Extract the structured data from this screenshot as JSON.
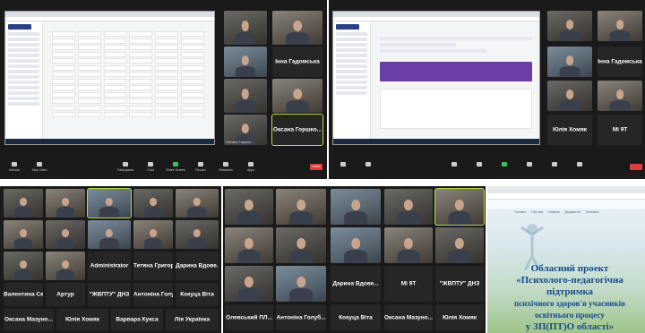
{
  "top_left": {
    "names": [
      "Інна Гадомська",
      "Оксана Горшко...",
      "Оксана Горшко..."
    ],
    "end_label": "Leave"
  },
  "top_right": {
    "names": [
      "Інна Гадомська",
      "Юлія Хомяк",
      "Мі 9Т"
    ]
  },
  "bottom_left": {
    "names": [
      "Administrator",
      "Тетяна Григорук",
      "Дарина Вдове...",
      "Валентина Сеще...",
      "Артур",
      "\"ЖВПТУ\" ДНЗ",
      "Антоніна Голуб...",
      "Кокуца Віта",
      "Оксана Мазуно...",
      "Юлія Хомяк",
      "Варвара Кукса",
      "Лія Українка"
    ]
  },
  "bottom_mid": {
    "names": [
      "Олевський ПЛ...",
      "Антоніна Голуб...",
      "Кокуца Віта",
      "Дарина Вдове...",
      "Мі 9Т",
      "\"ЖВПТУ\" ДНЗ",
      "Оксана Мазуно...",
      "Юлія Хомяк"
    ]
  },
  "website": {
    "nav": [
      "Головна",
      "Про нас",
      "Новини",
      "Документи",
      "Контакти"
    ],
    "title_lines": [
      "Обласний проект",
      "«Психолого-педагогічна підтримка",
      "психічного здоров'я учасників освітнього процесу",
      "у ЗП(ПТ)О області»"
    ]
  },
  "zoom_toolbar": [
    "Unmute",
    "Stop Video",
    "Participants",
    "Chat",
    "Share Screen",
    "Record",
    "Reactions",
    "Apps"
  ]
}
